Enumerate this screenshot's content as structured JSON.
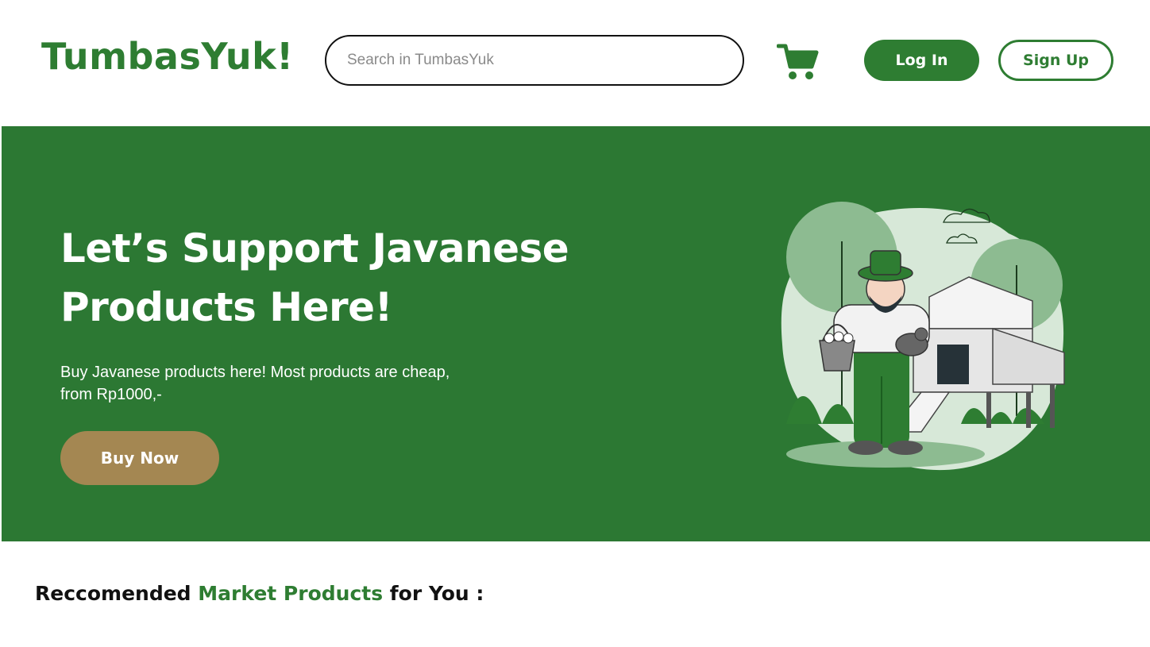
{
  "header": {
    "logo": "TumbasYuk!",
    "search_placeholder": "Search in TumbasYuk",
    "search_value": "",
    "cart_icon": "shopping-cart-icon",
    "login_label": "Log In",
    "signup_label": "Sign Up"
  },
  "hero": {
    "title_line1": "Let’s Support Javanese",
    "title_line2": "Products Here!",
    "subtitle": "Buy Javanese products here! Most products are cheap, from Rp1000,-",
    "buy_label": "Buy Now",
    "illustration": "farmer-with-chicken-coop-illustration"
  },
  "recommended": {
    "prefix": "Reccomended ",
    "highlight": "Market Products",
    "suffix": " for You :"
  },
  "colors": {
    "brand_green": "#2e7d32",
    "hero_green": "#2c7833",
    "buy_button": "#a48752",
    "text_dark": "#111111"
  }
}
